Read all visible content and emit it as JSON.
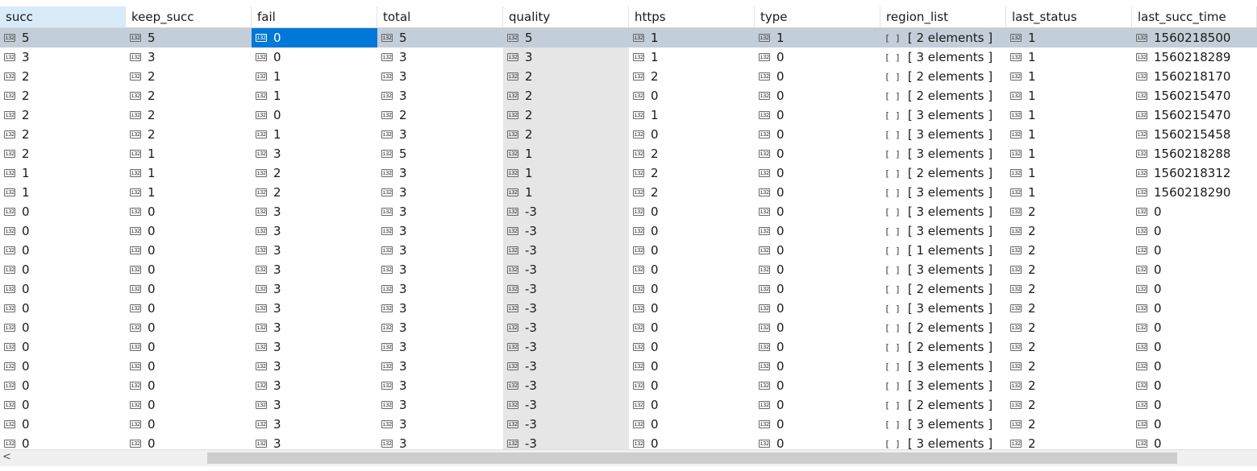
{
  "table": {
    "columns": [
      "succ",
      "keep_succ",
      "fail",
      "total",
      "quality",
      "https",
      "type",
      "region_list",
      "last_status",
      "last_succ_time"
    ],
    "sort_indicator": "^",
    "int_icon": "i32",
    "array_icon": "[ ]",
    "rows": [
      [
        "5",
        "5",
        "0",
        "5",
        "5",
        "1",
        "1",
        "[ 2 elements ]",
        "1",
        "1560218500"
      ],
      [
        "3",
        "3",
        "0",
        "3",
        "3",
        "1",
        "0",
        "[ 3 elements ]",
        "1",
        "1560218289"
      ],
      [
        "2",
        "2",
        "1",
        "3",
        "2",
        "2",
        "0",
        "[ 2 elements ]",
        "1",
        "1560218170"
      ],
      [
        "2",
        "2",
        "1",
        "3",
        "2",
        "0",
        "0",
        "[ 2 elements ]",
        "1",
        "1560215470"
      ],
      [
        "2",
        "2",
        "0",
        "2",
        "2",
        "1",
        "0",
        "[ 3 elements ]",
        "1",
        "1560215470"
      ],
      [
        "2",
        "2",
        "1",
        "3",
        "2",
        "0",
        "0",
        "[ 3 elements ]",
        "1",
        "1560215458"
      ],
      [
        "2",
        "1",
        "3",
        "5",
        "1",
        "2",
        "0",
        "[ 3 elements ]",
        "1",
        "1560218288"
      ],
      [
        "1",
        "1",
        "2",
        "3",
        "1",
        "2",
        "0",
        "[ 2 elements ]",
        "1",
        "1560218312"
      ],
      [
        "1",
        "1",
        "2",
        "3",
        "1",
        "2",
        "0",
        "[ 3 elements ]",
        "1",
        "1560218290"
      ],
      [
        "0",
        "0",
        "3",
        "3",
        "-3",
        "0",
        "0",
        "[ 3 elements ]",
        "2",
        "0"
      ],
      [
        "0",
        "0",
        "3",
        "3",
        "-3",
        "0",
        "0",
        "[ 3 elements ]",
        "2",
        "0"
      ],
      [
        "0",
        "0",
        "3",
        "3",
        "-3",
        "0",
        "0",
        "[ 1 elements ]",
        "2",
        "0"
      ],
      [
        "0",
        "0",
        "3",
        "3",
        "-3",
        "0",
        "0",
        "[ 3 elements ]",
        "2",
        "0"
      ],
      [
        "0",
        "0",
        "3",
        "3",
        "-3",
        "0",
        "0",
        "[ 2 elements ]",
        "2",
        "0"
      ],
      [
        "0",
        "0",
        "3",
        "3",
        "-3",
        "0",
        "0",
        "[ 3 elements ]",
        "2",
        "0"
      ],
      [
        "0",
        "0",
        "3",
        "3",
        "-3",
        "0",
        "0",
        "[ 2 elements ]",
        "2",
        "0"
      ],
      [
        "0",
        "0",
        "3",
        "3",
        "-3",
        "0",
        "0",
        "[ 2 elements ]",
        "2",
        "0"
      ],
      [
        "0",
        "0",
        "3",
        "3",
        "-3",
        "0",
        "0",
        "[ 3 elements ]",
        "2",
        "0"
      ],
      [
        "0",
        "0",
        "3",
        "3",
        "-3",
        "0",
        "0",
        "[ 3 elements ]",
        "2",
        "0"
      ],
      [
        "0",
        "0",
        "3",
        "3",
        "-3",
        "0",
        "0",
        "[ 2 elements ]",
        "2",
        "0"
      ],
      [
        "0",
        "0",
        "3",
        "3",
        "-3",
        "0",
        "0",
        "[ 3 elements ]",
        "2",
        "0"
      ],
      [
        "0",
        "0",
        "3",
        "3",
        "-3",
        "0",
        "0",
        "[ 3 elements ]",
        "2",
        "0"
      ]
    ]
  },
  "scrollbar": {
    "left_arrow": "<"
  }
}
